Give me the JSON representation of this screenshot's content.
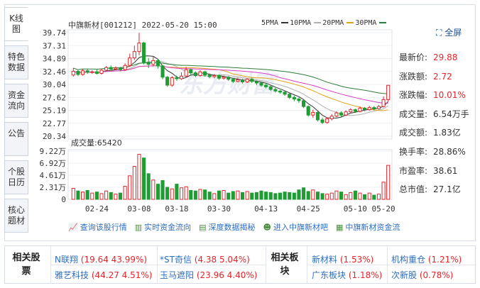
{
  "tabs": [
    {
      "label": "K线图"
    },
    {
      "label": "特色数据"
    },
    {
      "label": "资金流向"
    },
    {
      "label": "公告"
    },
    {
      "label": "个股日历"
    },
    {
      "label": "核心题材"
    }
  ],
  "chart_header": {
    "title": "中旗新材[001212] 2022-05-20 15:00"
  },
  "ma_legend": [
    {
      "label": "5PMA",
      "color": "#333333"
    },
    {
      "label": "10PMA",
      "color": "#b0b0b0"
    },
    {
      "label": "20PMA",
      "color": "#e3a21a"
    },
    {
      "label": "30PMA",
      "color": "#d63ecb"
    }
  ],
  "ma_last_color": "#2e7d3a",
  "fullscreen_label": "全屏",
  "stats": [
    {
      "key": "最新价:",
      "value": "29.88",
      "red": true
    },
    {
      "key": "涨跌额:",
      "value": "2.72",
      "red": true
    },
    {
      "key": "涨跌幅:",
      "value": "10.01%",
      "red": true
    },
    {
      "key": "成交量:",
      "value": "6.54万手",
      "red": false
    },
    {
      "key": "成交额:",
      "value": "1.83亿",
      "red": false
    },
    {
      "key": "换手率:",
      "value": "28.86%",
      "red": false
    },
    {
      "key": "市盈率:",
      "value": "38.61",
      "red": false
    },
    {
      "key": "总市值:",
      "value": "27.1亿",
      "red": false
    }
  ],
  "chart_data": {
    "type": "candlestick",
    "price_ticks": [
      "39.74",
      "37.31",
      "34.89",
      "32.46",
      "30.04",
      "27.62",
      "25.19",
      "22.77",
      "20.34"
    ],
    "price_range": [
      20.34,
      39.74
    ],
    "volume_label": "成交量:65420",
    "volume_ticks": [
      "9.22万",
      "6.92万",
      "4.61万",
      "2.31万",
      "0"
    ],
    "volume_range": [
      0,
      9.22
    ],
    "x_ticks": [
      "02-24",
      "03-08",
      "03-18",
      "03-30",
      "04-13",
      "04-25",
      "05-10",
      "05-20"
    ],
    "watermark": "东方财富",
    "candles": [
      [
        31.8,
        32.5,
        33.1,
        31.5,
        2.1
      ],
      [
        32.5,
        31.9,
        32.8,
        31.6,
        1.6
      ],
      [
        31.9,
        32.6,
        32.9,
        31.7,
        1.4
      ],
      [
        32.6,
        32.3,
        33.0,
        32.0,
        1.7
      ],
      [
        32.3,
        32.4,
        32.7,
        32.0,
        1.2
      ],
      [
        32.4,
        32.1,
        32.8,
        31.9,
        1.4
      ],
      [
        32.1,
        32.7,
        33.0,
        31.9,
        1.1
      ],
      [
        32.7,
        33.2,
        33.5,
        32.4,
        1.6
      ],
      [
        33.2,
        32.9,
        33.6,
        32.6,
        1.3
      ],
      [
        32.9,
        33.1,
        33.4,
        32.7,
        1.0
      ],
      [
        33.1,
        32.8,
        33.3,
        32.5,
        1.2
      ],
      [
        32.8,
        33.6,
        34.0,
        32.6,
        2.5
      ],
      [
        33.6,
        35.0,
        35.8,
        33.3,
        4.5
      ],
      [
        35.0,
        36.2,
        37.3,
        34.6,
        6.3
      ],
      [
        36.2,
        37.8,
        39.7,
        35.5,
        8.6
      ],
      [
        37.8,
        34.2,
        38.0,
        33.8,
        7.9
      ],
      [
        34.2,
        33.8,
        35.0,
        33.1,
        4.9
      ],
      [
        33.8,
        34.5,
        35.2,
        33.4,
        3.7
      ],
      [
        34.5,
        33.5,
        34.8,
        33.0,
        2.9
      ],
      [
        33.5,
        31.4,
        33.7,
        31.0,
        3.6
      ],
      [
        31.4,
        29.9,
        31.6,
        29.6,
        2.3
      ],
      [
        29.9,
        31.3,
        31.6,
        29.6,
        2.0
      ],
      [
        31.3,
        31.1,
        31.7,
        30.7,
        2.9
      ],
      [
        31.1,
        31.6,
        32.3,
        30.9,
        2.2
      ],
      [
        31.6,
        32.8,
        33.3,
        31.4,
        2.4
      ],
      [
        32.8,
        32.2,
        33.0,
        31.8,
        1.7
      ],
      [
        32.2,
        31.7,
        32.5,
        31.4,
        1.6
      ],
      [
        31.7,
        32.4,
        32.7,
        31.5,
        1.9
      ],
      [
        32.4,
        31.8,
        32.6,
        31.5,
        1.8
      ],
      [
        31.8,
        31.5,
        32.1,
        31.2,
        1.4
      ],
      [
        31.5,
        31.7,
        32.0,
        31.2,
        1.1
      ],
      [
        31.7,
        31.2,
        31.9,
        30.9,
        1.6
      ],
      [
        31.2,
        31.4,
        31.7,
        30.9,
        1.7
      ],
      [
        31.4,
        31.0,
        31.6,
        30.7,
        1.2
      ],
      [
        31.0,
        30.6,
        31.2,
        30.3,
        1.5
      ],
      [
        30.6,
        30.9,
        31.3,
        30.4,
        1.6
      ],
      [
        30.9,
        30.5,
        31.1,
        30.2,
        1.3
      ],
      [
        30.5,
        31.0,
        31.2,
        30.3,
        1.5
      ],
      [
        31.0,
        30.6,
        31.3,
        30.3,
        1.2
      ],
      [
        30.6,
        30.3,
        30.8,
        29.9,
        1.3
      ],
      [
        30.3,
        29.9,
        30.5,
        29.6,
        1.6
      ],
      [
        29.9,
        29.6,
        30.2,
        29.3,
        1.4
      ],
      [
        29.6,
        29.1,
        29.8,
        28.8,
        1.3
      ],
      [
        29.1,
        28.8,
        29.4,
        28.5,
        1.1
      ],
      [
        28.8,
        28.6,
        29.0,
        28.3,
        1.2
      ],
      [
        28.6,
        28.2,
        28.9,
        27.9,
        1.4
      ],
      [
        28.2,
        27.6,
        28.4,
        27.3,
        1.3
      ],
      [
        27.6,
        27.3,
        27.9,
        26.9,
        1.2
      ],
      [
        27.3,
        27.0,
        27.6,
        26.6,
        1.8
      ],
      [
        27.0,
        25.9,
        27.2,
        25.6,
        2.2
      ],
      [
        25.9,
        24.3,
        26.1,
        24.0,
        1.5
      ],
      [
        24.3,
        24.8,
        25.3,
        23.8,
        1.8
      ],
      [
        24.8,
        23.4,
        25.0,
        23.1,
        1.4
      ],
      [
        23.4,
        22.9,
        23.8,
        22.6,
        1.1
      ],
      [
        22.9,
        23.6,
        23.9,
        22.7,
        1.0
      ],
      [
        23.6,
        24.1,
        24.5,
        23.3,
        1.2
      ],
      [
        24.1,
        24.7,
        25.0,
        23.9,
        1.6
      ],
      [
        24.7,
        24.3,
        25.0,
        24.0,
        1.4
      ],
      [
        24.3,
        24.9,
        25.2,
        24.1,
        0.9
      ],
      [
        24.9,
        25.3,
        25.6,
        24.6,
        1.3
      ],
      [
        25.3,
        25.0,
        25.5,
        24.7,
        1.6
      ],
      [
        25.0,
        25.6,
        25.9,
        24.8,
        1.2
      ],
      [
        25.6,
        25.3,
        25.8,
        25.0,
        0.9
      ],
      [
        25.3,
        25.7,
        26.0,
        25.1,
        1.2
      ],
      [
        25.7,
        25.5,
        26.0,
        25.2,
        0.8
      ],
      [
        25.5,
        25.9,
        26.2,
        25.3,
        1.0
      ],
      [
        25.9,
        27.2,
        27.8,
        25.7,
        3.3
      ],
      [
        27.2,
        29.88,
        29.88,
        26.9,
        6.5
      ]
    ]
  },
  "links": [
    {
      "icon": "chart-icon",
      "glyph": "📈",
      "label": "查询该股行情"
    },
    {
      "icon": "funds-flow-icon",
      "glyph": "▥",
      "label": "实时资金流向"
    },
    {
      "icon": "data-icon",
      "glyph": "▤",
      "label": "深度数据揭秘"
    },
    {
      "icon": "people-icon",
      "glyph": "☻",
      "label": "进入中旗新材吧"
    },
    {
      "icon": "money-icon",
      "glyph": "▦",
      "label": "中旗新材资金流"
    }
  ],
  "related_stocks": {
    "title": "相关股票",
    "items": [
      {
        "name": "N联翔",
        "detail": "(19.64 43.99%)"
      },
      {
        "name": "*ST奇信",
        "detail": "(4.38 5.04%)"
      },
      {
        "name": "雅艺科技",
        "detail": "(44.27 4.51%)"
      },
      {
        "name": "玉马遮阳",
        "detail": "(23.96 4.40%)"
      }
    ]
  },
  "related_sectors": {
    "title": "相关板块",
    "items": [
      {
        "name": "新材料",
        "detail": "(1.53%)"
      },
      {
        "name": "机构重仓",
        "detail": "(1.21%)"
      },
      {
        "name": "广东板块",
        "detail": "(1.18%)"
      },
      {
        "name": "次新股",
        "detail": "(0.78%)"
      }
    ]
  }
}
